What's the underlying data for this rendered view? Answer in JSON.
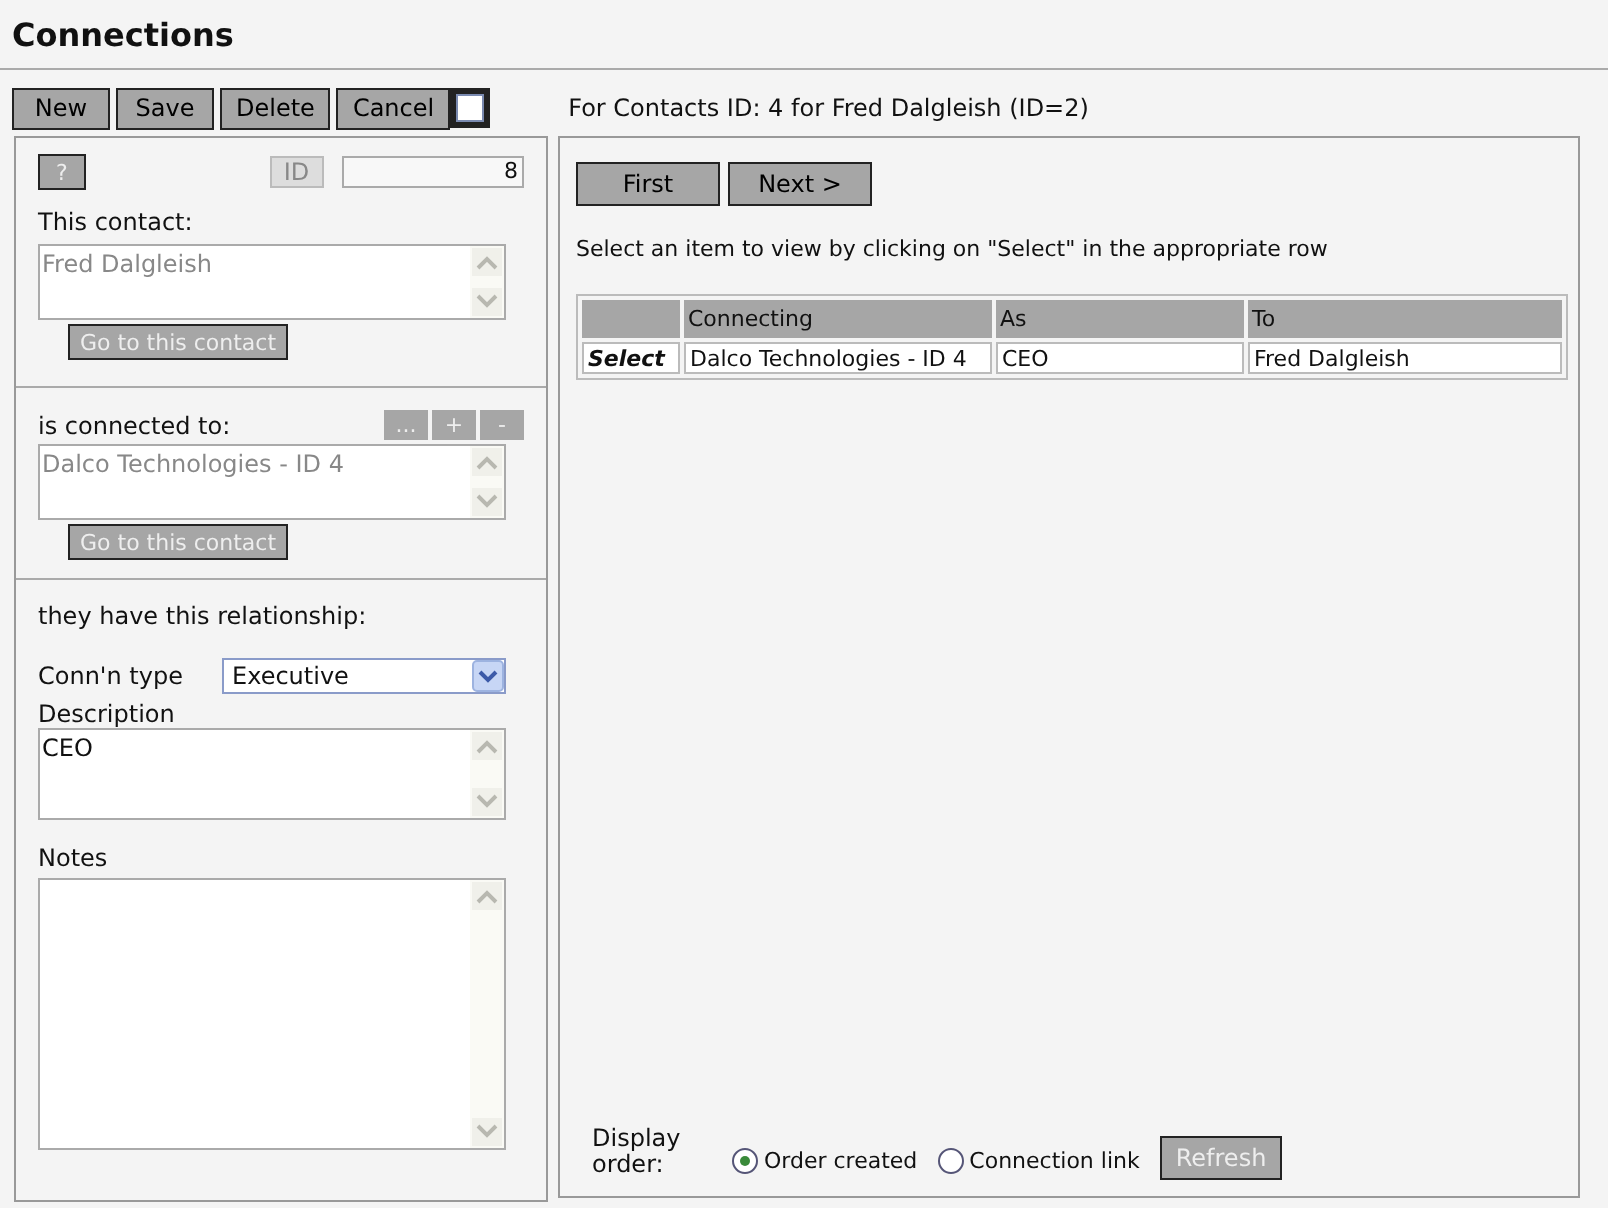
{
  "page": {
    "title": "Connections"
  },
  "toolbar": {
    "buttons": [
      {
        "label": "New"
      },
      {
        "label": "Save"
      },
      {
        "label": "Delete"
      },
      {
        "label": "Cancel"
      }
    ],
    "checkbox": {
      "checked": false
    },
    "context": "For Contacts ID: 4 for Fred Dalgleish (ID=2)"
  },
  "record": {
    "help_button": "?",
    "id_label": "ID",
    "id_value": "8",
    "this_contact": {
      "label": "This contact:",
      "value": "Fred Dalgleish",
      "disabled": true,
      "goto_button": {
        "label": "Go to this contact",
        "disabled": true
      }
    },
    "connected_to": {
      "label": "is connected to:",
      "actions": [
        "...",
        "+",
        "-"
      ],
      "value": "Dalco Technologies - ID 4",
      "disabled": true,
      "goto_button": {
        "label": "Go to this contact",
        "disabled": true
      }
    },
    "relationship": {
      "heading": "they have this relationship:",
      "type_label": "Conn'n type",
      "type_value": "Executive",
      "description_label": "Description",
      "description_value": "CEO",
      "notes_label": "Notes"
    }
  },
  "list": {
    "nav_buttons": [
      "First",
      "Next >"
    ],
    "instructions": "Select an item to view by clicking on \"Select\" in the appropriate row",
    "table": {
      "columns": [
        "Connecting",
        "As",
        "To"
      ],
      "rows": [
        {
          "action": "Select",
          "cells": [
            "Dalco Technologies - ID 4",
            "CEO",
            "Fred Dalgleish"
          ]
        }
      ]
    }
  },
  "display_order": {
    "label": "Display order:",
    "options": [
      {
        "label": "Order created",
        "selected": true
      },
      {
        "label": "Connection link",
        "selected": false
      }
    ],
    "refresh_button": {
      "label": "Refresh",
      "disabled": true
    }
  }
}
